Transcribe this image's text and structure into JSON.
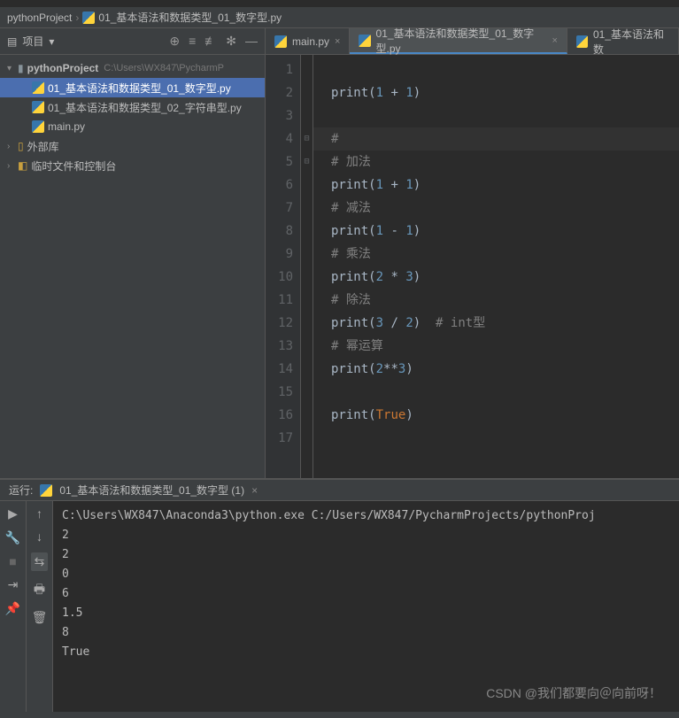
{
  "breadcrumb": {
    "root": "pythonProject",
    "file": "01_基本语法和数据类型_01_数字型.py"
  },
  "project_panel": {
    "title": "项目",
    "root_name": "pythonProject",
    "root_path": "C:\\Users\\WX847\\PycharmP",
    "files": [
      "01_基本语法和数据类型_01_数字型.py",
      "01_基本语法和数据类型_02_字符串型.py",
      "main.py"
    ],
    "ext_lib": "外部库",
    "scratches": "临时文件和控制台"
  },
  "tabs": [
    {
      "label": "main.py",
      "active": false
    },
    {
      "label": "01_基本语法和数据类型_01_数字型.py",
      "active": true
    },
    {
      "label": "01_基本语法和数"
    }
  ],
  "code_lines": [
    "1",
    "2",
    "3",
    "4",
    "5",
    "6",
    "7",
    "8",
    "9",
    "10",
    "11",
    "12",
    "13",
    "14",
    "15",
    "16",
    "17"
  ],
  "code": {
    "l2": {
      "fn": "print",
      "lp": "(",
      "n1": "1",
      "op": " + ",
      "n2": "1",
      "rp": ")"
    },
    "l4": "#",
    "l5": "# 加法",
    "l6": {
      "fn": "print",
      "lp": "(",
      "n1": "1",
      "op": " + ",
      "n2": "1",
      "rp": ")"
    },
    "l7": "# 减法",
    "l8": {
      "fn": "print",
      "lp": "(",
      "n1": "1",
      "op": " - ",
      "n2": "1",
      "rp": ")"
    },
    "l9": "# 乘法",
    "l10": {
      "fn": "print",
      "lp": "(",
      "n1": "2",
      "op": " * ",
      "n2": "3",
      "rp": ")"
    },
    "l11": "# 除法",
    "l12": {
      "fn": "print",
      "lp": "(",
      "n1": "3",
      "op": " / ",
      "n2": "2",
      "rp": ")",
      "trail": "  # int型"
    },
    "l13": "# 幂运算",
    "l14": {
      "fn": "print",
      "lp": "(",
      "n1": "2",
      "op": "**",
      "n2": "3",
      "rp": ")"
    },
    "l16": {
      "fn": "print",
      "lp": "(",
      "b": "True",
      "rp": ")"
    }
  },
  "run": {
    "label": "运行:",
    "config": "01_基本语法和数据类型_01_数字型 (1)",
    "cmd": "C:\\Users\\WX847\\Anaconda3\\python.exe C:/Users/WX847/PycharmProjects/pythonProj",
    "out": [
      "2",
      "2",
      "0",
      "6",
      "1.5",
      "8",
      "True"
    ]
  },
  "watermark": "CSDN @我们都要向＠向前呀！"
}
